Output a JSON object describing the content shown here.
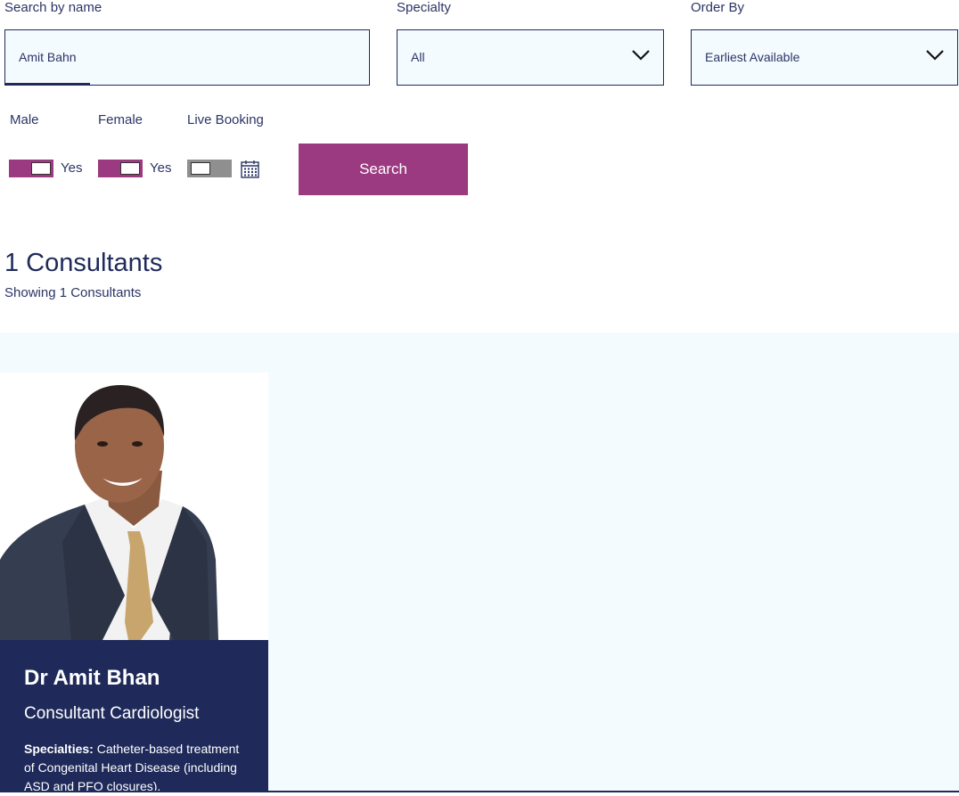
{
  "search": {
    "name_label": "Search by name",
    "name_value": "Amit Bahn",
    "specialty_label": "Specialty",
    "specialty_value": "All",
    "order_label": "Order By",
    "order_value": "Earliest Available"
  },
  "filters": {
    "male_label": "Male",
    "male_state": "Yes",
    "female_label": "Female",
    "female_state": "Yes",
    "live_label": "Live Booking",
    "search_button": "Search"
  },
  "results": {
    "heading": "1 Consultants",
    "subheading": "Showing 1 Consultants"
  },
  "consultant": {
    "name": "Dr Amit Bhan",
    "title": "Consultant Cardiologist",
    "specialties_label": "Specialties:",
    "specialties_text": "Catheter-based treatment of Congenital Heart Disease (including ASD and PFO closures),"
  },
  "colors": {
    "navy": "#1f2a5a",
    "accent": "#9b3a80",
    "panel": "#f4fbff"
  },
  "icons": {
    "dropdown": "chevron-down-icon",
    "calendar": "calendar-icon"
  }
}
